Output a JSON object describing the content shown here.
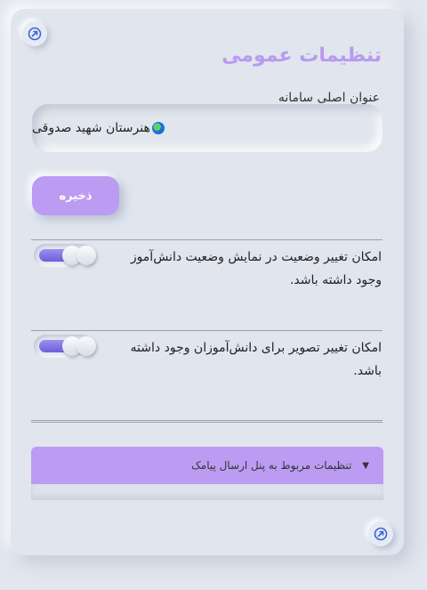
{
  "card": {
    "title": "تنظیمات عمومی",
    "system_title_label": "عنوان اصلی سامانه",
    "system_title_value": "هنرستان شهید صدوقی",
    "save_label": "ذخیره"
  },
  "settings": [
    {
      "text": "امکان تغییر وضعیت در نمایش وضعیت دانش‌آموز وجود داشته باشد.",
      "enabled": true
    },
    {
      "text": "امکان تغییر تصویر برای دانش‌آموزان وجود داشته باشد.",
      "enabled": true
    }
  ],
  "accordion": {
    "label": "تنظیمات مربوط به پنل ارسال پیامک",
    "caret": "▼"
  },
  "icons": {
    "corner": "arrow-up-right-circle-icon",
    "globe": "globe-icon"
  },
  "colors": {
    "accent": "#bb9cf2",
    "title": "#b89af0",
    "background": "#e0e5ee"
  }
}
